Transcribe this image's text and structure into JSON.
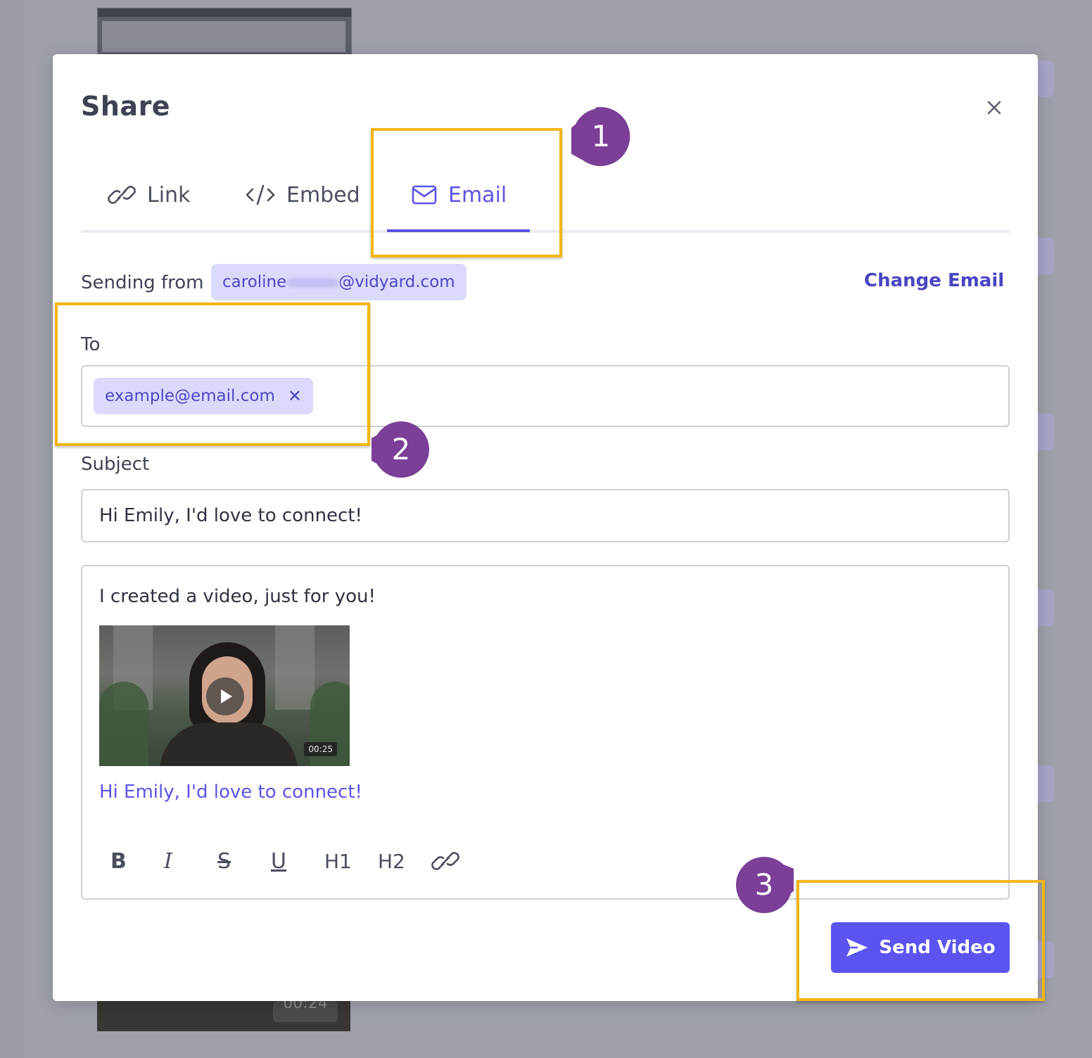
{
  "modal": {
    "title": "Share",
    "tabs": [
      {
        "label": "Link",
        "icon": "link-icon"
      },
      {
        "label": "Embed",
        "icon": "code-icon"
      },
      {
        "label": "Email",
        "icon": "mail-icon",
        "active": true
      }
    ],
    "sending_from_label": "Sending from",
    "sending_from_prefix": "caroline",
    "sending_from_suffix": "@vidyard.com",
    "change_email_label": "Change Email",
    "to_label": "To",
    "recipient": "example@email.com",
    "recipient_remove": "✕",
    "subject_label": "Subject",
    "subject_value": "Hi Emily, I'd love to connect!",
    "body": {
      "intro": "I created a video, just for you!",
      "video_duration": "00:25",
      "video_link": "Hi Emily, I'd love to connect!"
    },
    "toolbar": [
      "B",
      "I",
      "S",
      "U",
      "H1",
      "H2"
    ],
    "send_label": "Send Video"
  },
  "annotations": {
    "markers": [
      "1",
      "2",
      "3"
    ],
    "highlight_color": "#f3b614",
    "marker_color": "#7b3f98"
  },
  "background": {
    "thumbnail_duration": "00:24"
  },
  "colors": {
    "accent": "#5b54e6",
    "chip_bg": "#dcdafb",
    "send_button": "#5b54f0"
  }
}
